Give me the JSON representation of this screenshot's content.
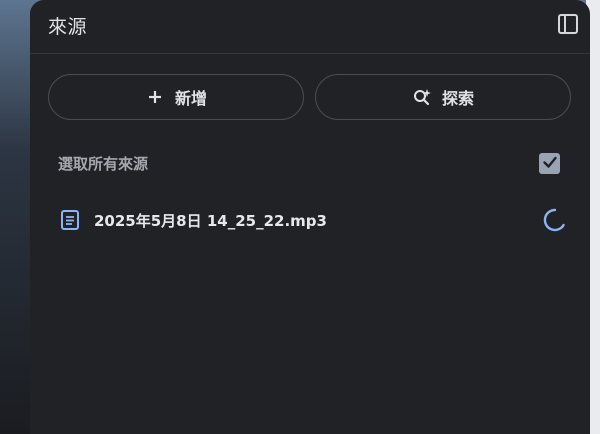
{
  "panel": {
    "title": "來源",
    "collapse_icon": "sidebar-panel-icon"
  },
  "actions": {
    "add": {
      "label": "新增",
      "icon": "plus-icon"
    },
    "discover": {
      "label": "探索",
      "icon": "search-sparkle-icon"
    }
  },
  "select_all": {
    "label": "選取所有來源",
    "checked": true
  },
  "sources": [
    {
      "name": "2025年5月8日 14_25_22.mp3",
      "icon": "document-icon",
      "status": "loading"
    }
  ],
  "colors": {
    "panel_bg": "#202226",
    "accent_blue": "#8ab4f8",
    "checkbox_bg": "#9aa3b3",
    "border": "#4a4c52"
  }
}
